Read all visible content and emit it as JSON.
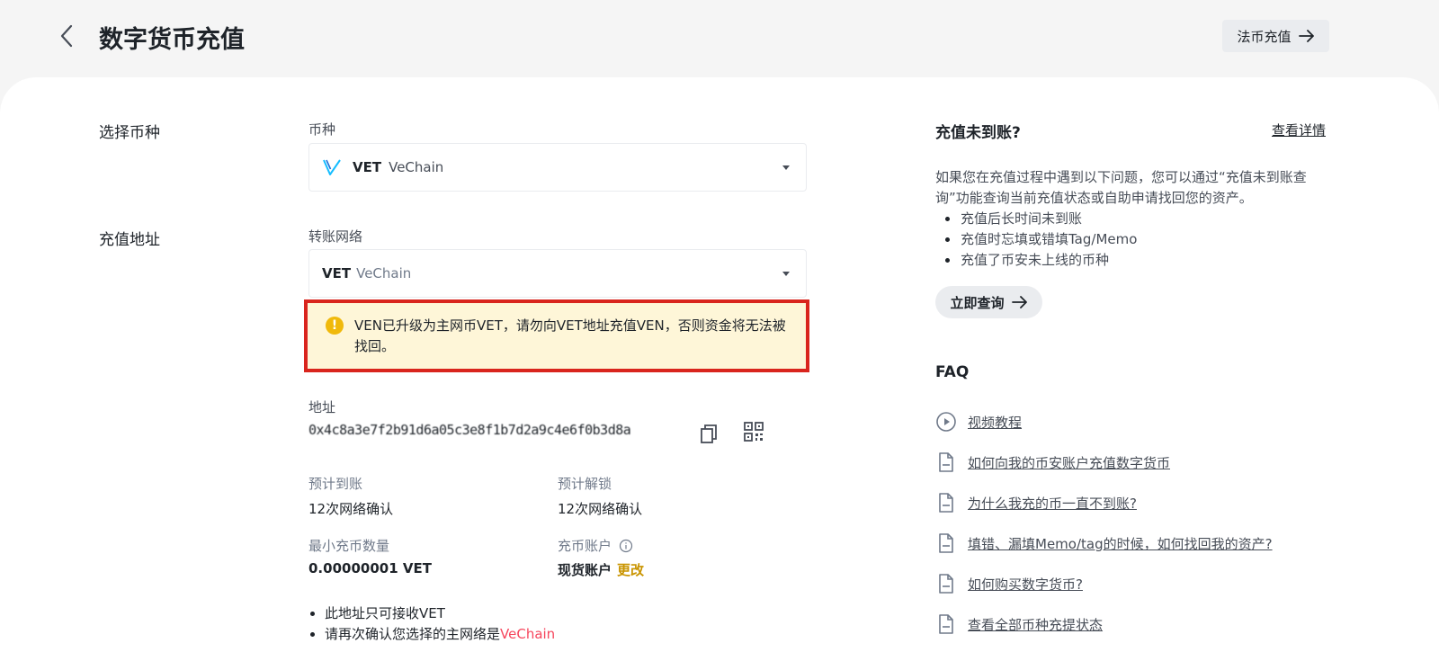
{
  "header": {
    "title": "数字货币充值",
    "fiat_button": "法币充值"
  },
  "form": {
    "coin_section_label": "选择币种",
    "coin_field_label": "币种",
    "coin_symbol": "VET",
    "coin_name": "VeChain",
    "address_section_label": "充值地址",
    "network_field_label": "转账网络",
    "network_symbol": "VET",
    "network_name": "VeChain",
    "warning": "VEN已升级为主网币VET，请勿向VET地址充值VEN，否则资金将无法被找回。",
    "address_label": "地址",
    "address_value": "0x4c8a3e7f2b91d6a05c3e8f1b7d2a9c4e6f0b3d8a",
    "expected_arrival_label": "预计到账",
    "expected_arrival_value": "12次网络确认",
    "expected_unlock_label": "预计解锁",
    "expected_unlock_value": "12次网络确认",
    "min_deposit_label": "最小充币数量",
    "min_deposit_value": "0.00000001 VET",
    "deposit_account_label": "充币账户",
    "deposit_account_value": "现货账户",
    "change_label": "更改",
    "notes": {
      "note1": "此地址只可接收VET",
      "note2_prefix": "请再次确认您选择的主网络是",
      "note2_network": "VeChain"
    }
  },
  "sidebar": {
    "title": "充值未到账?",
    "details_link": "查看详情",
    "description": "如果您在充值过程中遇到以下问题，您可以通过“充值未到账查询”功能查询当前充值状态或自助申请找回您的资产。",
    "issues": {
      "issue1": "充值后长时间未到账",
      "issue2": "充值时忘填或错填Tag/Memo",
      "issue3": "充值了币安未上线的币种"
    },
    "query_button": "立即查询",
    "faq_title": "FAQ",
    "faq": {
      "item1": "视频教程",
      "item2": "如何向我的币安账户充值数字货币",
      "item3": "为什么我充的币一直不到账?",
      "item4": "填错、漏填Memo/tag的时候，如何找回我的资产?",
      "item5": "如何购买数字货币?",
      "item6": "查看全部币种充提状态"
    }
  },
  "colors": {
    "accent": "#f0b90b",
    "link_gold": "#c99400",
    "warning_border": "#d9251d",
    "danger_text": "#f6465d"
  }
}
